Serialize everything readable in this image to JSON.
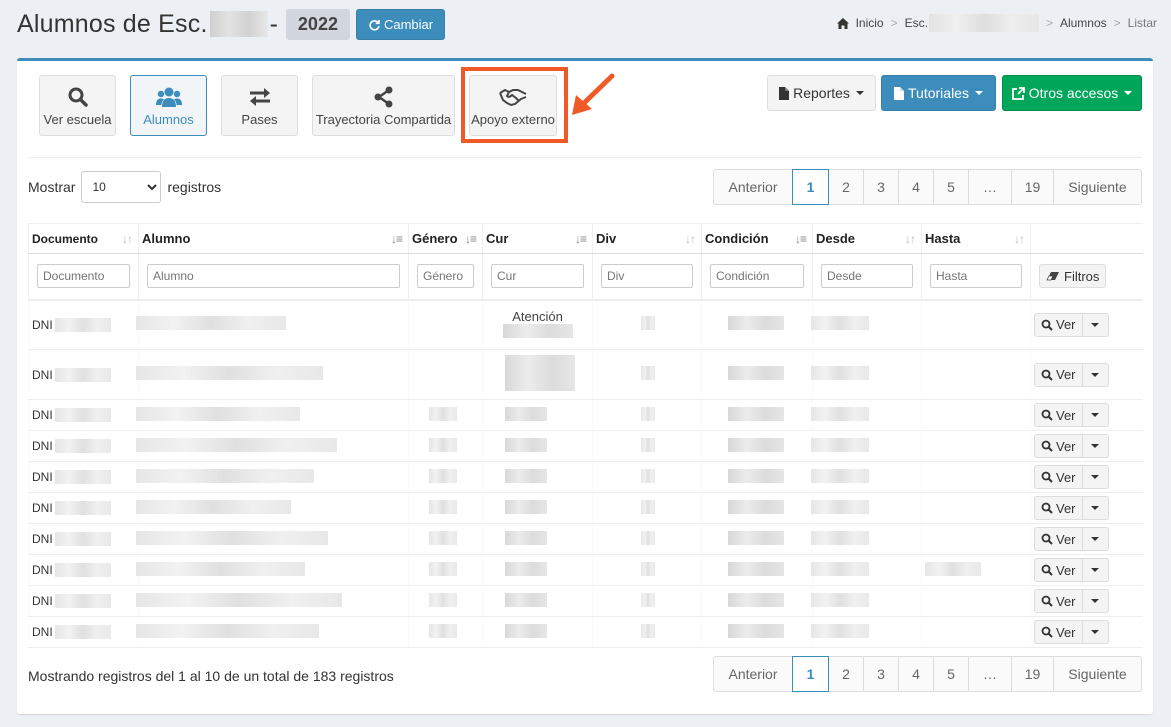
{
  "header": {
    "title": "Alumnos de Esc.",
    "dash": "-",
    "year": "2022",
    "cambiar_label": "Cambiar"
  },
  "breadcrumb": {
    "home": "Inicio",
    "school": "Esc.",
    "section": "Alumnos",
    "current": "Listar",
    "separator": ">"
  },
  "app_buttons": [
    {
      "label": "Ver escuela",
      "icon": "search-icon"
    },
    {
      "label": "Alumnos",
      "icon": "users-icon"
    },
    {
      "label": "Pases",
      "icon": "exchange-icon"
    },
    {
      "label": "Trayectoria Compartida",
      "icon": "share-icon"
    },
    {
      "label": "Apoyo externo",
      "icon": "handshake-icon"
    }
  ],
  "toolbar": {
    "reportes": "Reportes",
    "tutoriales": "Tutoriales",
    "otros": "Otros accesos"
  },
  "length": {
    "mostrar": "Mostrar",
    "value": "10",
    "registros": "registros"
  },
  "pagination": {
    "prev": "Anterior",
    "pages": [
      "1",
      "2",
      "3",
      "4",
      "5",
      "…",
      "19"
    ],
    "current": "1",
    "next": "Siguiente"
  },
  "table": {
    "columns": [
      "Documento",
      "Alumno",
      "Género",
      "Cur",
      "Div",
      "Condición",
      "Desde",
      "Hasta"
    ],
    "placeholders": [
      "Documento",
      "Alumno",
      "Género",
      "Cur",
      "Div",
      "Condición",
      "Desde",
      "Hasta"
    ],
    "filtros_label": "Filtros",
    "row_prefix": "DNI",
    "ver_label": "Ver",
    "first_row_cur": "Atención"
  },
  "footer": {
    "info": "Mostrando registros del 1 al 10 de un total de 183 registros"
  },
  "colors": {
    "primary": "#3c8dbc",
    "success": "#00a65a",
    "highlight": "#f05a28"
  }
}
